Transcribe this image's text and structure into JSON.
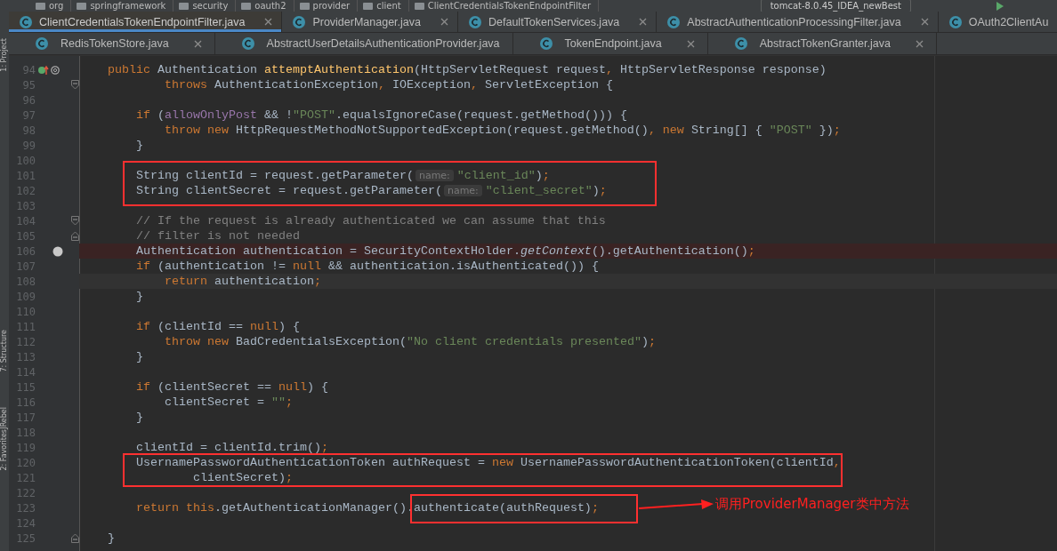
{
  "breadcrumb": {
    "items": [
      "org",
      "springframework",
      "security",
      "oauth2",
      "provider",
      "client",
      "ClientCredentialsTokenEndpointFilter"
    ],
    "run_config": "tomcat-8.0.45_IDEA_newBest"
  },
  "tool_strip": [
    "1: Project",
    "7: Structure",
    "JRebel",
    "2: Favorites"
  ],
  "tab_rows": [
    [
      {
        "label": "ClientCredentialsTokenEndpointFilter.java",
        "selected": true,
        "closable": true
      },
      {
        "label": "ProviderManager.java",
        "selected": false,
        "closable": true
      },
      {
        "label": "DefaultTokenServices.java",
        "selected": false,
        "closable": true
      },
      {
        "label": "AbstractAuthenticationProcessingFilter.java",
        "selected": false,
        "closable": true
      },
      {
        "label": "OAuth2ClientAu",
        "selected": false,
        "closable": false
      }
    ],
    [
      {
        "label": "RedisTokenStore.java",
        "selected": false,
        "closable": true
      },
      {
        "label": "AbstractUserDetailsAuthenticationProvider.java",
        "selected": false,
        "closable": false
      },
      {
        "label": "TokenEndpoint.java",
        "selected": false,
        "closable": true
      },
      {
        "label": "AbstractTokenGranter.java",
        "selected": false,
        "closable": true
      }
    ]
  ],
  "lines": [
    {
      "number": "94",
      "kind": "override",
      "breakpoint": false,
      "current": false,
      "tokens": [
        {
          "kind": "kw",
          "text": "    public "
        },
        {
          "kind": "plain",
          "text": "Authentication "
        },
        {
          "kind": "method",
          "text": "attemptAuthentication"
        },
        {
          "kind": "plain",
          "text": "(HttpServletRequest request"
        },
        {
          "kind": "kw",
          "text": ", "
        },
        {
          "kind": "plain",
          "text": "HttpServletResponse response)"
        }
      ]
    },
    {
      "number": "95",
      "kind": "fold-start",
      "breakpoint": false,
      "current": false,
      "tokens": [
        {
          "kind": "kw",
          "text": "            throws "
        },
        {
          "kind": "plain",
          "text": "AuthenticationException"
        },
        {
          "kind": "kw",
          "text": ", "
        },
        {
          "kind": "plain",
          "text": "IOException"
        },
        {
          "kind": "kw",
          "text": ", "
        },
        {
          "kind": "plain",
          "text": "ServletException {"
        }
      ]
    },
    {
      "number": "96",
      "kind": "code",
      "breakpoint": false,
      "current": false
    },
    {
      "number": "97",
      "kind": "code",
      "breakpoint": false,
      "current": false,
      "tokens": [
        {
          "kind": "kw",
          "text": "        if "
        },
        {
          "kind": "plain",
          "text": "("
        },
        {
          "kind": "field",
          "text": "allowOnlyPost"
        },
        {
          "kind": "plain",
          "text": " && !"
        },
        {
          "kind": "str",
          "text": "\"POST\""
        },
        {
          "kind": "plain",
          "text": ".equalsIgnoreCase(request.getMethod())) {"
        }
      ]
    },
    {
      "number": "98",
      "kind": "code",
      "breakpoint": false,
      "current": false,
      "tokens": [
        {
          "kind": "kw",
          "text": "            throw new "
        },
        {
          "kind": "plain",
          "text": "HttpRequestMethodNotSupportedException(request.getMethod()"
        },
        {
          "kind": "kw",
          "text": ", new "
        },
        {
          "kind": "plain",
          "text": "String[] { "
        },
        {
          "kind": "str",
          "text": "\"POST\""
        },
        {
          "kind": "plain",
          "text": " })"
        },
        {
          "kind": "kw",
          "text": ";"
        }
      ]
    },
    {
      "number": "99",
      "kind": "code",
      "breakpoint": false,
      "current": false,
      "tokens": [
        {
          "kind": "plain",
          "text": "        }"
        }
      ]
    },
    {
      "number": "100",
      "kind": "code",
      "breakpoint": false,
      "current": false
    },
    {
      "number": "101",
      "kind": "code",
      "breakpoint": false,
      "current": false,
      "tokens": [
        {
          "kind": "plain",
          "text": "        String clientId = request.getParameter("
        },
        {
          "kind": "hint",
          "text": "name:"
        },
        {
          "kind": "str",
          "text": "\"client_id\""
        },
        {
          "kind": "plain",
          "text": ")"
        },
        {
          "kind": "kw",
          "text": ";"
        }
      ]
    },
    {
      "number": "102",
      "kind": "code",
      "breakpoint": false,
      "current": false,
      "tokens": [
        {
          "kind": "plain",
          "text": "        String clientSecret = request.getParameter("
        },
        {
          "kind": "hint",
          "text": "name:"
        },
        {
          "kind": "str",
          "text": "\"client_secret\""
        },
        {
          "kind": "plain",
          "text": ")"
        },
        {
          "kind": "kw",
          "text": ";"
        }
      ]
    },
    {
      "number": "103",
      "kind": "code",
      "breakpoint": false,
      "current": false
    },
    {
      "number": "104",
      "kind": "fold-start",
      "breakpoint": false,
      "current": false,
      "tokens": [
        {
          "kind": "comment",
          "text": "        // If the request is already authenticated we can assume that this"
        }
      ]
    },
    {
      "number": "105",
      "kind": "fold-end",
      "breakpoint": false,
      "current": false,
      "tokens": [
        {
          "kind": "comment",
          "text": "        // filter is not needed"
        }
      ]
    },
    {
      "number": "106",
      "kind": "code",
      "breakpoint": true,
      "current": false,
      "tokens": [
        {
          "kind": "plain",
          "text": "        Authentication authentication = SecurityContextHolder."
        },
        {
          "kind": "italic",
          "text": "getContext"
        },
        {
          "kind": "plain",
          "text": "().getAuthentication()"
        },
        {
          "kind": "kw",
          "text": ";"
        }
      ]
    },
    {
      "number": "107",
      "kind": "code",
      "breakpoint": false,
      "current": false,
      "tokens": [
        {
          "kind": "kw",
          "text": "        if "
        },
        {
          "kind": "plain",
          "text": "(authentication != "
        },
        {
          "kind": "kw",
          "text": "null "
        },
        {
          "kind": "plain",
          "text": "&& authentication.isAuthenticated()) {"
        }
      ]
    },
    {
      "number": "108",
      "kind": "code",
      "breakpoint": false,
      "current": true,
      "tokens": [
        {
          "kind": "kw",
          "text": "            return "
        },
        {
          "kind": "plain",
          "text": "authentication"
        },
        {
          "kind": "kw",
          "text": ";"
        }
      ]
    },
    {
      "number": "109",
      "kind": "code",
      "breakpoint": false,
      "current": false,
      "tokens": [
        {
          "kind": "plain",
          "text": "        }"
        }
      ]
    },
    {
      "number": "110",
      "kind": "code",
      "breakpoint": false,
      "current": false
    },
    {
      "number": "111",
      "kind": "code",
      "breakpoint": false,
      "current": false,
      "tokens": [
        {
          "kind": "kw",
          "text": "        if "
        },
        {
          "kind": "plain",
          "text": "(clientId == "
        },
        {
          "kind": "kw",
          "text": "null"
        },
        {
          "kind": "plain",
          "text": ") {"
        }
      ]
    },
    {
      "number": "112",
      "kind": "code",
      "breakpoint": false,
      "current": false,
      "tokens": [
        {
          "kind": "kw",
          "text": "            throw new "
        },
        {
          "kind": "plain",
          "text": "BadCredentialsException("
        },
        {
          "kind": "str",
          "text": "\"No client credentials presented\""
        },
        {
          "kind": "plain",
          "text": ")"
        },
        {
          "kind": "kw",
          "text": ";"
        }
      ]
    },
    {
      "number": "113",
      "kind": "code",
      "breakpoint": false,
      "current": false,
      "tokens": [
        {
          "kind": "plain",
          "text": "        }"
        }
      ]
    },
    {
      "number": "114",
      "kind": "code",
      "breakpoint": false,
      "current": false
    },
    {
      "number": "115",
      "kind": "code",
      "breakpoint": false,
      "current": false,
      "tokens": [
        {
          "kind": "kw",
          "text": "        if "
        },
        {
          "kind": "plain",
          "text": "(clientSecret == "
        },
        {
          "kind": "kw",
          "text": "null"
        },
        {
          "kind": "plain",
          "text": ") {"
        }
      ]
    },
    {
      "number": "116",
      "kind": "code",
      "breakpoint": false,
      "current": false,
      "tokens": [
        {
          "kind": "plain",
          "text": "            clientSecret = "
        },
        {
          "kind": "str",
          "text": "\"\""
        },
        {
          "kind": "kw",
          "text": ";"
        }
      ]
    },
    {
      "number": "117",
      "kind": "code",
      "breakpoint": false,
      "current": false,
      "tokens": [
        {
          "kind": "plain",
          "text": "        }"
        }
      ]
    },
    {
      "number": "118",
      "kind": "code",
      "breakpoint": false,
      "current": false
    },
    {
      "number": "119",
      "kind": "code",
      "breakpoint": false,
      "current": false,
      "tokens": [
        {
          "kind": "plain",
          "text": "        clientId = clientId.trim()"
        },
        {
          "kind": "kw",
          "text": ";"
        }
      ]
    },
    {
      "number": "120",
      "kind": "code",
      "breakpoint": false,
      "current": false,
      "tokens": [
        {
          "kind": "plain",
          "text": "        UsernamePasswordAuthenticationToken authRequest = "
        },
        {
          "kind": "kw",
          "text": "new "
        },
        {
          "kind": "plain",
          "text": "UsernamePasswordAuthenticationToken(clientId"
        },
        {
          "kind": "kw",
          "text": ","
        }
      ]
    },
    {
      "number": "121",
      "kind": "code",
      "breakpoint": false,
      "current": false,
      "tokens": [
        {
          "kind": "plain",
          "text": "                clientSecret)"
        },
        {
          "kind": "kw",
          "text": ";"
        }
      ]
    },
    {
      "number": "122",
      "kind": "code",
      "breakpoint": false,
      "current": false
    },
    {
      "number": "123",
      "kind": "code",
      "breakpoint": false,
      "current": false,
      "tokens": [
        {
          "kind": "kw",
          "text": "        return this"
        },
        {
          "kind": "plain",
          "text": ".getAuthenticationManager().authenticate(authRequest)"
        },
        {
          "kind": "kw",
          "text": ";"
        }
      ]
    },
    {
      "number": "124",
      "kind": "code",
      "breakpoint": false,
      "current": false
    },
    {
      "number": "125",
      "kind": "fold-end",
      "breakpoint": false,
      "current": false,
      "tokens": [
        {
          "kind": "plain",
          "text": "    }"
        }
      ]
    }
  ],
  "callout": {
    "text": "调用ProviderManager类中方法"
  }
}
